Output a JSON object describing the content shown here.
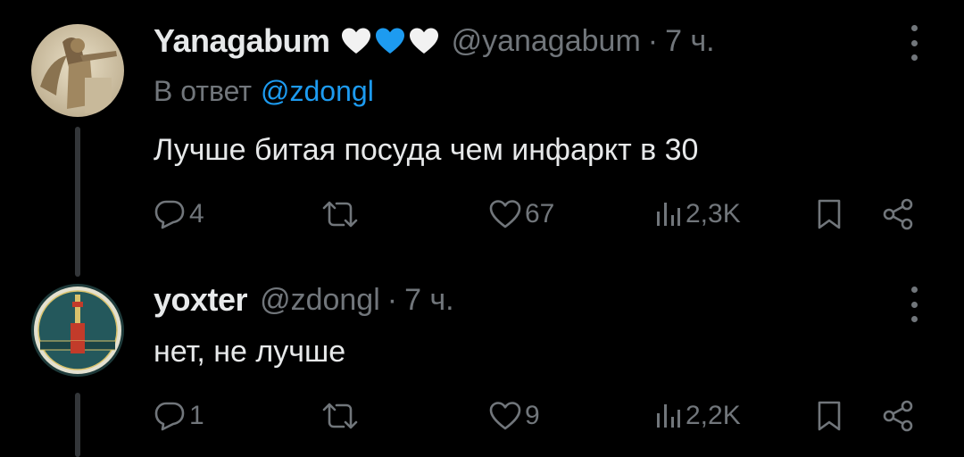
{
  "tweets": [
    {
      "display_name": "Yanagabum",
      "hearts": [
        "white-heart",
        "blue-heart",
        "white-heart"
      ],
      "handle": "@yanagabum",
      "separator": "·",
      "time": "7 ч.",
      "reply_prefix": "В ответ",
      "reply_handle": "@zdongl",
      "text": "Лучше битая посуда чем инфаркт в 30",
      "stats": {
        "replies": "4",
        "retweets": "",
        "likes": "67",
        "views": "2,3K"
      }
    },
    {
      "display_name": "yoxter",
      "handle": "@zdongl",
      "separator": "·",
      "time": "7 ч.",
      "text": "нет, не лучше",
      "stats": {
        "replies": "1",
        "retweets": "",
        "likes": "9",
        "views": "2,2K"
      }
    }
  ],
  "colors": {
    "background": "#000000",
    "primary_text": "#e7e9ea",
    "secondary_text": "#71767b",
    "link": "#1d9bf0",
    "blue_heart": "#1d9bf0",
    "white_heart": "#f2f2f2"
  },
  "icons": [
    "more-icon",
    "reply-icon",
    "retweet-icon",
    "like-icon",
    "views-icon",
    "bookmark-icon",
    "share-icon"
  ]
}
